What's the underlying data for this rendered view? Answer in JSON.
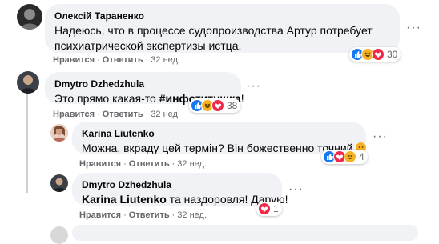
{
  "comments": [
    {
      "author": "Олексій Тараненко",
      "text_line1": "Надеюсь, что в процессе судопроизводства Артур потребует",
      "text_line2": "психиатрической экспертизы истца.",
      "like": "Нравится",
      "reply": "Ответить",
      "time": "32 нед.",
      "reactions_count": "30"
    },
    {
      "author": "Dmytro Dzhedzhula",
      "text_prefix": "Это прямо какая-то ",
      "text_bold": "#инфотитушка",
      "text_suffix": "!",
      "like": "Нравится",
      "reply": "Ответить",
      "time": "32 нед.",
      "reactions_count": "38"
    },
    {
      "author": "Karina Liutenko",
      "text": "Можна, вкраду цей термін? Він божественно точний",
      "like": "Нравится",
      "reply": "Ответить",
      "time": "32 нед.",
      "reactions_count": "4"
    },
    {
      "author": "Dmytro Dzhedzhula",
      "mention": "Karina Liutenko",
      "text": " та наздоровля! Дарую!",
      "like": "Нравится",
      "reply": "Ответить",
      "time": "32 нед.",
      "reactions_count": "1"
    }
  ],
  "colors": {
    "bubble": "#f0f2f5",
    "meta": "#65676b",
    "like": "#1877f2",
    "haha": "#f7b125",
    "love": "#f02849"
  },
  "icons": {
    "more": "more-horizontal-icon",
    "like": "like-reaction-icon",
    "haha": "haha-reaction-icon",
    "love": "love-reaction-icon"
  }
}
